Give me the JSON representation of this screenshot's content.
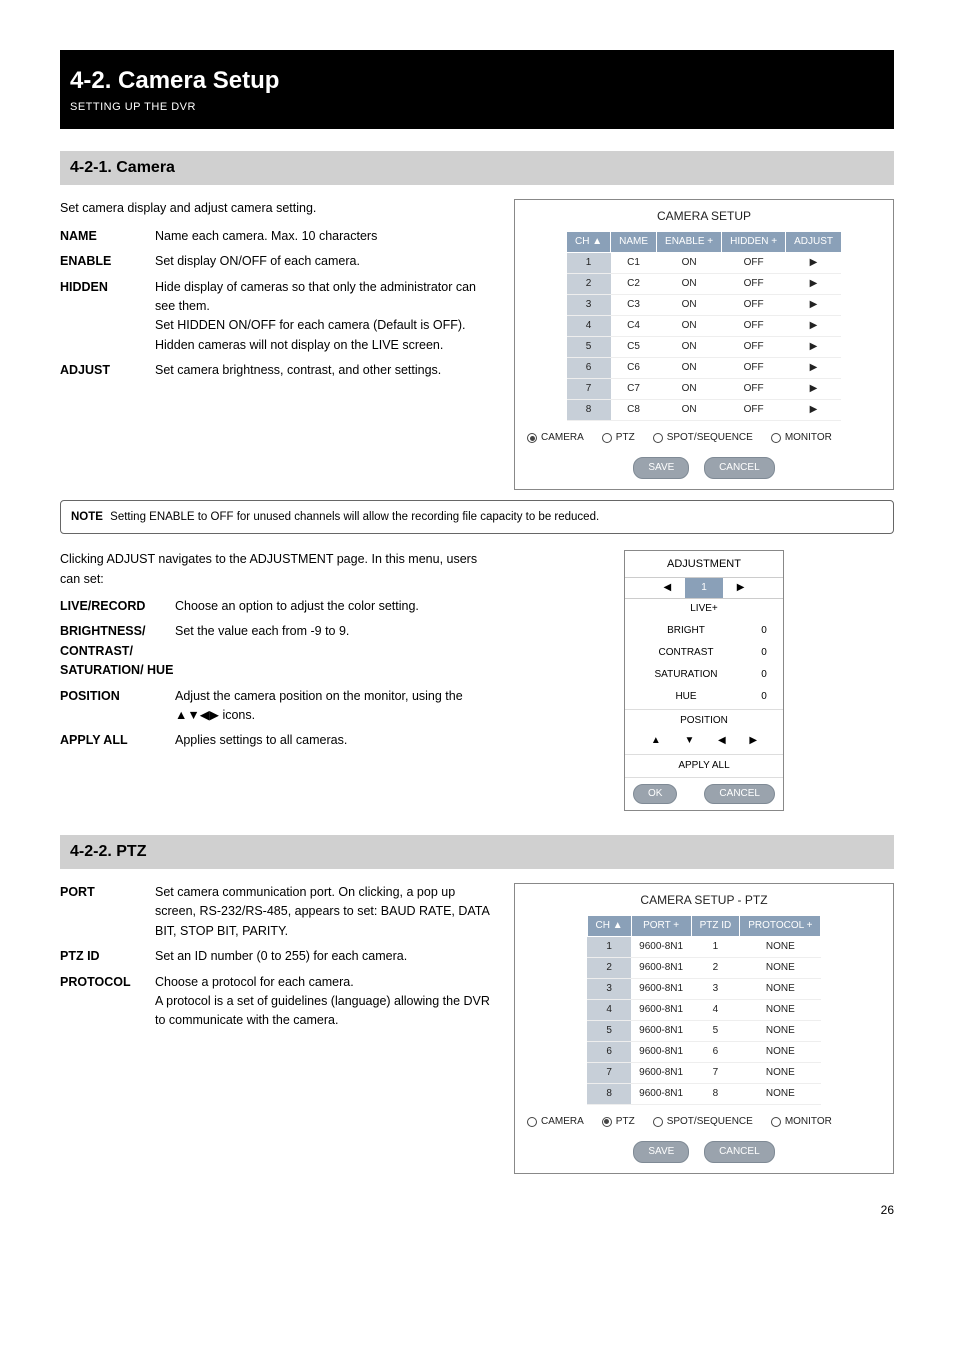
{
  "header": {
    "main": "4-2. Camera Setup",
    "sub": "SETTING UP THE DVR"
  },
  "sections": {
    "camera": {
      "bar": "4-2-1. Camera",
      "intro": "Set camera display and adjust camera setting.",
      "fields": [
        {
          "lbl": "NAME",
          "desc": "Name each camera. Max. 10 characters"
        },
        {
          "lbl": "ENABLE",
          "desc": "Set display ON/OFF of each camera."
        },
        {
          "lbl": "HIDDEN",
          "desc": "Hide display of cameras so that only the administrator can see them.\nSet HIDDEN ON/OFF for each camera (Default is OFF).\nHidden cameras will not display on the LIVE screen."
        },
        {
          "lbl": "ADJUST",
          "desc": "Set camera brightness, contrast, and other settings."
        }
      ],
      "note": {
        "label": "NOTE",
        "text": "Setting ENABLE to OFF for unused channels will allow the recording file capacity to be reduced."
      },
      "adjust_intro": "Clicking ADJUST navigates to the ADJUSTMENT page. In this menu, users can set:",
      "adjust_items": [
        {
          "lbl": "LIVE/RECORD",
          "desc": "Choose an option to adjust the color setting."
        },
        {
          "lbl": "BRIGHTNESS/ CONTRAST/ SATURATION/ HUE",
          "desc": "Set the value each from -9 to 9."
        },
        {
          "lbl": "POSITION",
          "desc": "Adjust the camera position on the monitor, using the ▲▼◀▶ icons."
        },
        {
          "lbl": "APPLY ALL",
          "desc": "Applies settings to all cameras."
        }
      ],
      "shot": {
        "title": "CAMERA SETUP",
        "headers": [
          "CH ▲",
          "NAME",
          "ENABLE +",
          "HIDDEN +",
          "ADJUST"
        ],
        "rows": [
          [
            "1",
            "C1",
            "ON",
            "OFF",
            "▶"
          ],
          [
            "2",
            "C2",
            "ON",
            "OFF",
            "▶"
          ],
          [
            "3",
            "C3",
            "ON",
            "OFF",
            "▶"
          ],
          [
            "4",
            "C4",
            "ON",
            "OFF",
            "▶"
          ],
          [
            "5",
            "C5",
            "ON",
            "OFF",
            "▶"
          ],
          [
            "6",
            "C6",
            "ON",
            "OFF",
            "▶"
          ],
          [
            "7",
            "C7",
            "ON",
            "OFF",
            "▶"
          ],
          [
            "8",
            "C8",
            "ON",
            "OFF",
            "▶"
          ]
        ],
        "radios": [
          {
            "label": "CAMERA",
            "selected": true
          },
          {
            "label": "PTZ",
            "selected": false
          },
          {
            "label": "SPOT/SEQUENCE",
            "selected": false
          },
          {
            "label": "MONITOR",
            "selected": false
          }
        ],
        "buttons": {
          "save": "SAVE",
          "cancel": "CANCEL"
        }
      },
      "adj_shot": {
        "title": "ADJUSTMENT",
        "channel": "1",
        "live": "LIVE+",
        "rows": [
          {
            "lbl": "BRIGHT",
            "val": "0"
          },
          {
            "lbl": "CONTRAST",
            "val": "0"
          },
          {
            "lbl": "SATURATION",
            "val": "0"
          },
          {
            "lbl": "HUE",
            "val": "0"
          }
        ],
        "position": "POSITION",
        "apply_all": "APPLY ALL",
        "ok": "OK",
        "cancel": "CANCEL"
      }
    },
    "ptz": {
      "bar": "4-2-2. PTZ",
      "fields": [
        {
          "lbl": "PORT",
          "desc": "Set camera communication port. On clicking, a pop up screen, RS-232/RS-485, appears to set: BAUD RATE, DATA BIT, STOP BIT, PARITY."
        },
        {
          "lbl": "PTZ ID",
          "desc": "Set an ID number (0 to 255) for each camera."
        },
        {
          "lbl": "PROTOCOL",
          "desc": "Choose a protocol for each camera.\nA protocol is a set of guidelines (language) allowing the DVR to communicate with the camera."
        }
      ],
      "shot": {
        "title": "CAMERA SETUP - PTZ",
        "headers": [
          "CH ▲",
          "PORT +",
          "PTZ ID",
          "PROTOCOL +"
        ],
        "rows": [
          [
            "1",
            "9600-8N1",
            "1",
            "NONE"
          ],
          [
            "2",
            "9600-8N1",
            "2",
            "NONE"
          ],
          [
            "3",
            "9600-8N1",
            "3",
            "NONE"
          ],
          [
            "4",
            "9600-8N1",
            "4",
            "NONE"
          ],
          [
            "5",
            "9600-8N1",
            "5",
            "NONE"
          ],
          [
            "6",
            "9600-8N1",
            "6",
            "NONE"
          ],
          [
            "7",
            "9600-8N1",
            "7",
            "NONE"
          ],
          [
            "8",
            "9600-8N1",
            "8",
            "NONE"
          ]
        ],
        "radios": [
          {
            "label": "CAMERA",
            "selected": false
          },
          {
            "label": "PTZ",
            "selected": true
          },
          {
            "label": "SPOT/SEQUENCE",
            "selected": false
          },
          {
            "label": "MONITOR",
            "selected": false
          }
        ],
        "buttons": {
          "save": "SAVE",
          "cancel": "CANCEL"
        }
      }
    }
  },
  "page_number": "26"
}
